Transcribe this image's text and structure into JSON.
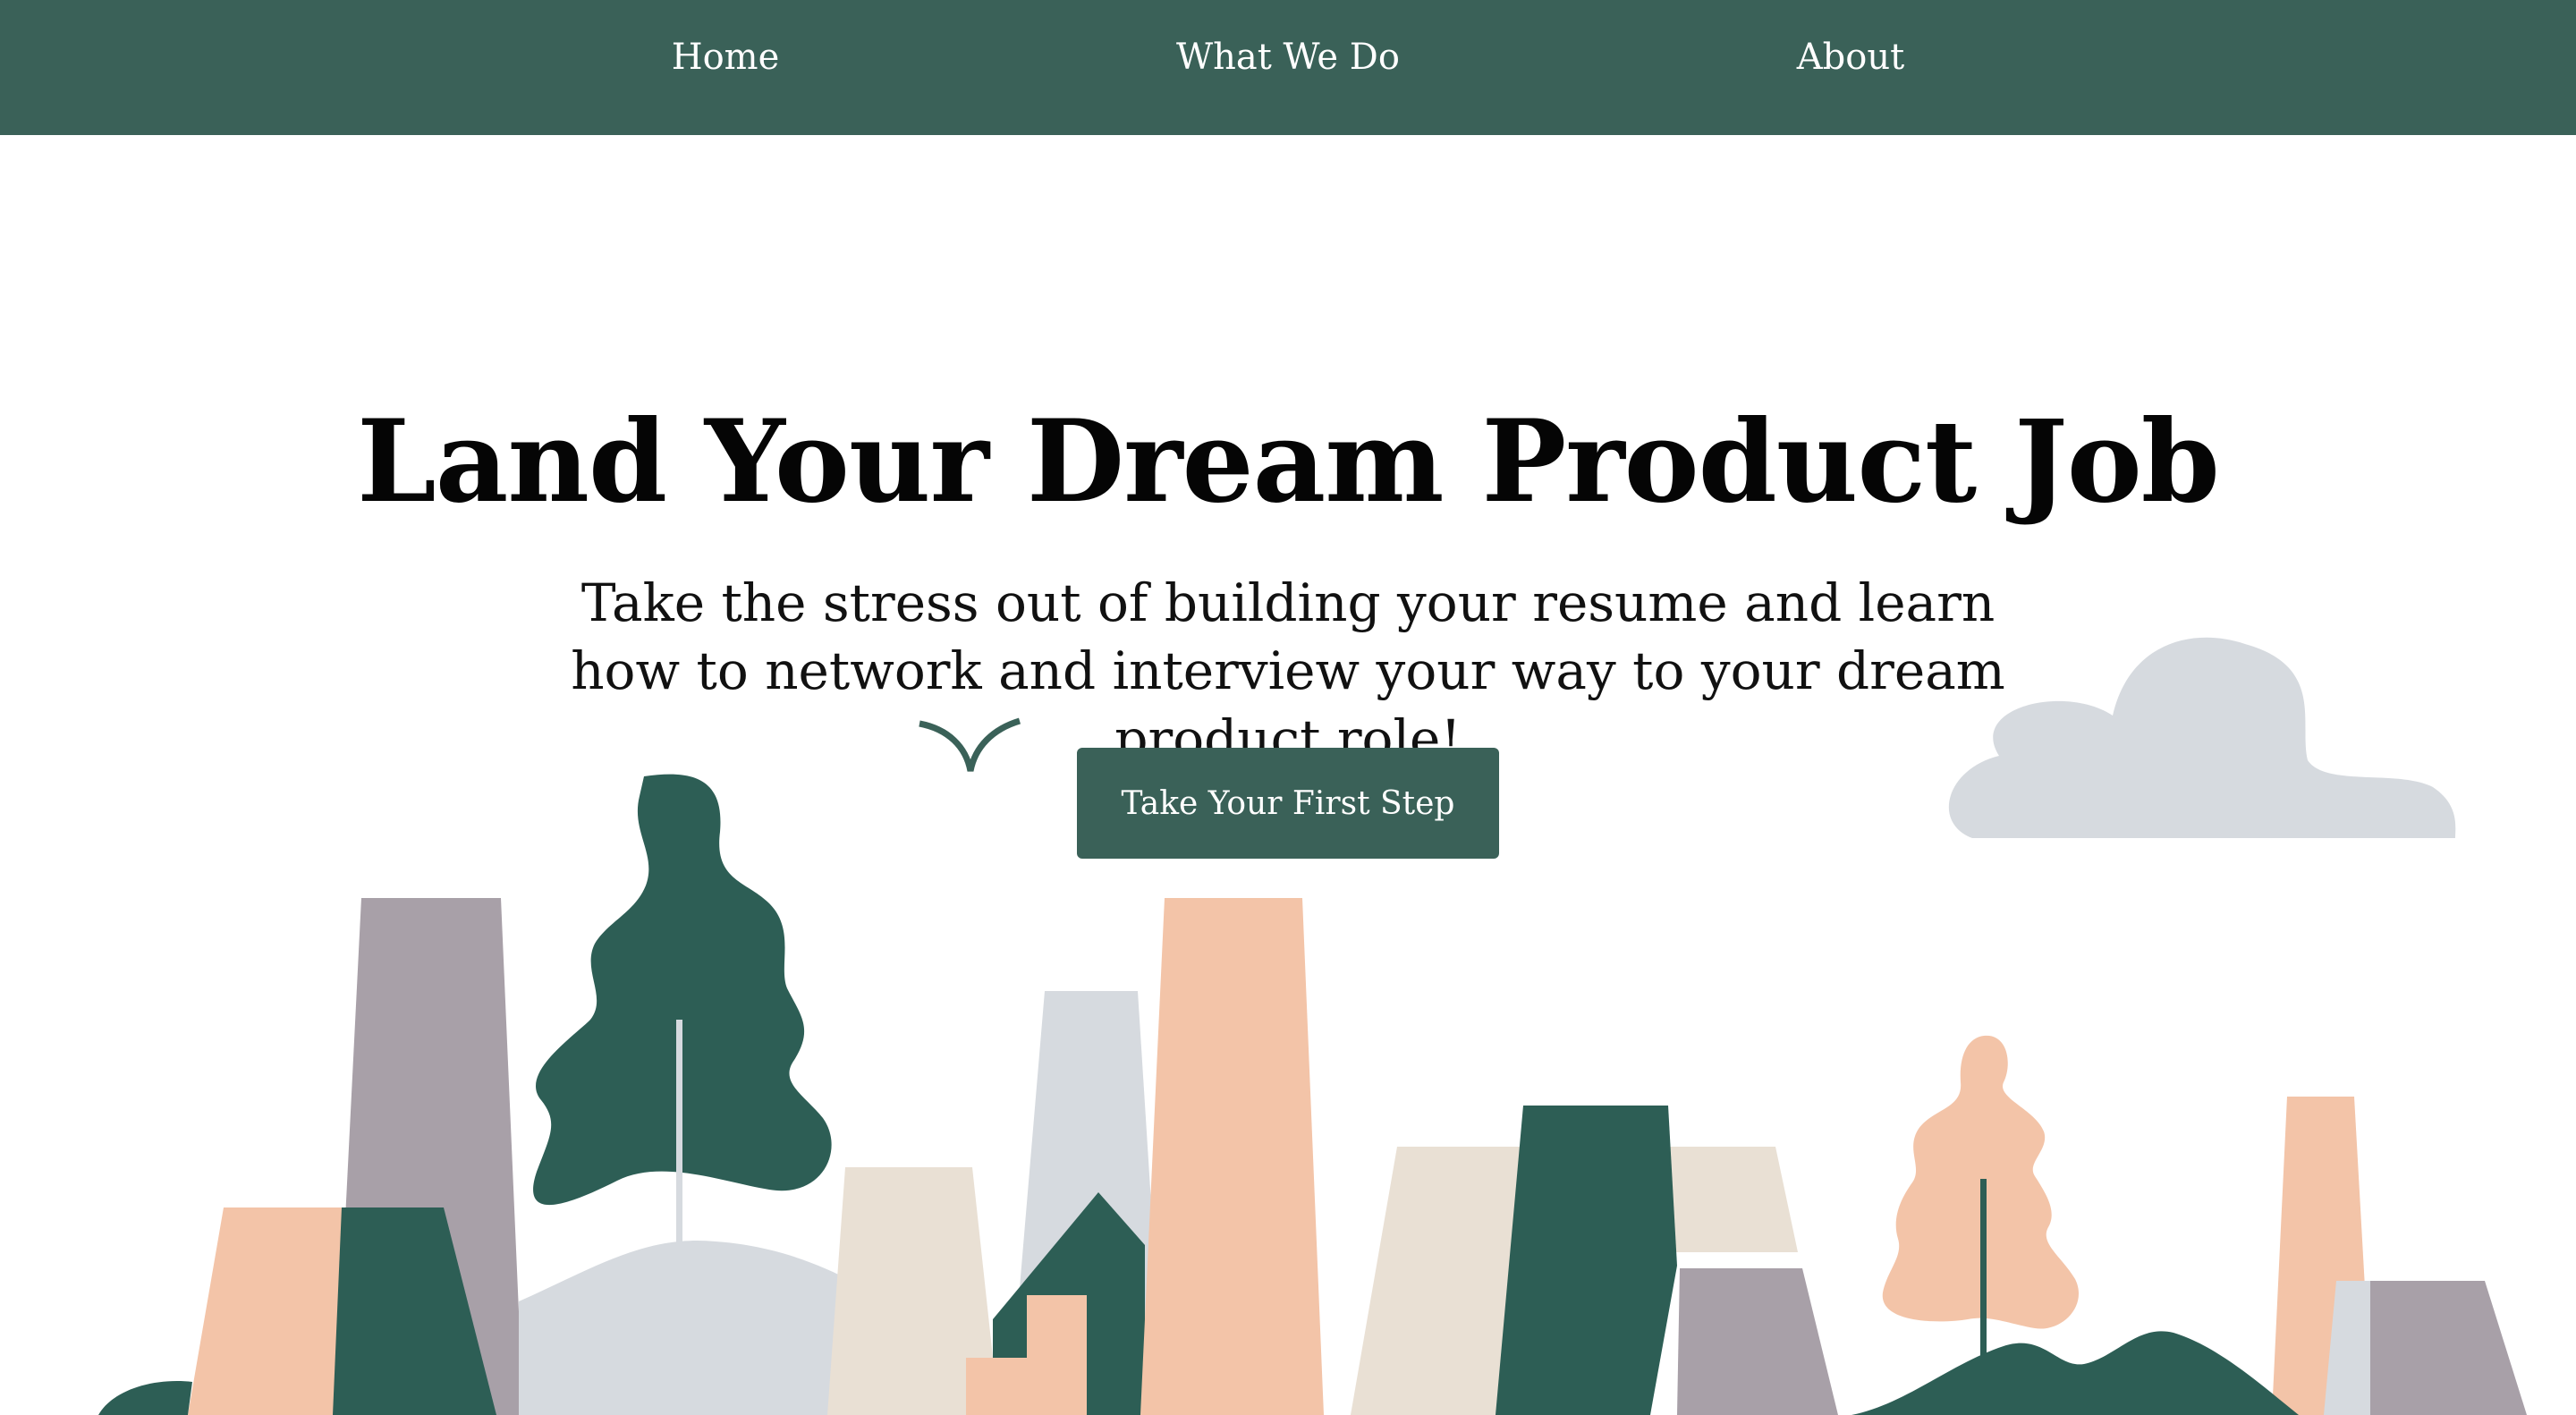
{
  "nav": {
    "links": [
      {
        "label": "Home"
      },
      {
        "label": "What We Do"
      },
      {
        "label": "About"
      }
    ]
  },
  "hero": {
    "title": "Land Your Dream Product Job",
    "subtitle": "Take the stress out of building your resume and learn how to network and interview your way to your dream product role!",
    "cta_label": "Take Your First Step"
  },
  "colors": {
    "nav_bg": "#3a6158",
    "forest_green": "#2d5e55",
    "peach": "#f3c4a8",
    "mauve": "#a8a0a8",
    "light_gray": "#d6dadf",
    "cream": "#e9e0d4"
  },
  "illustration": {
    "name": "city-skyline-illustration",
    "icons": [
      "bird-icon",
      "cloud-icon",
      "tree-icon",
      "building-icon",
      "house-icon",
      "hill-icon"
    ]
  }
}
